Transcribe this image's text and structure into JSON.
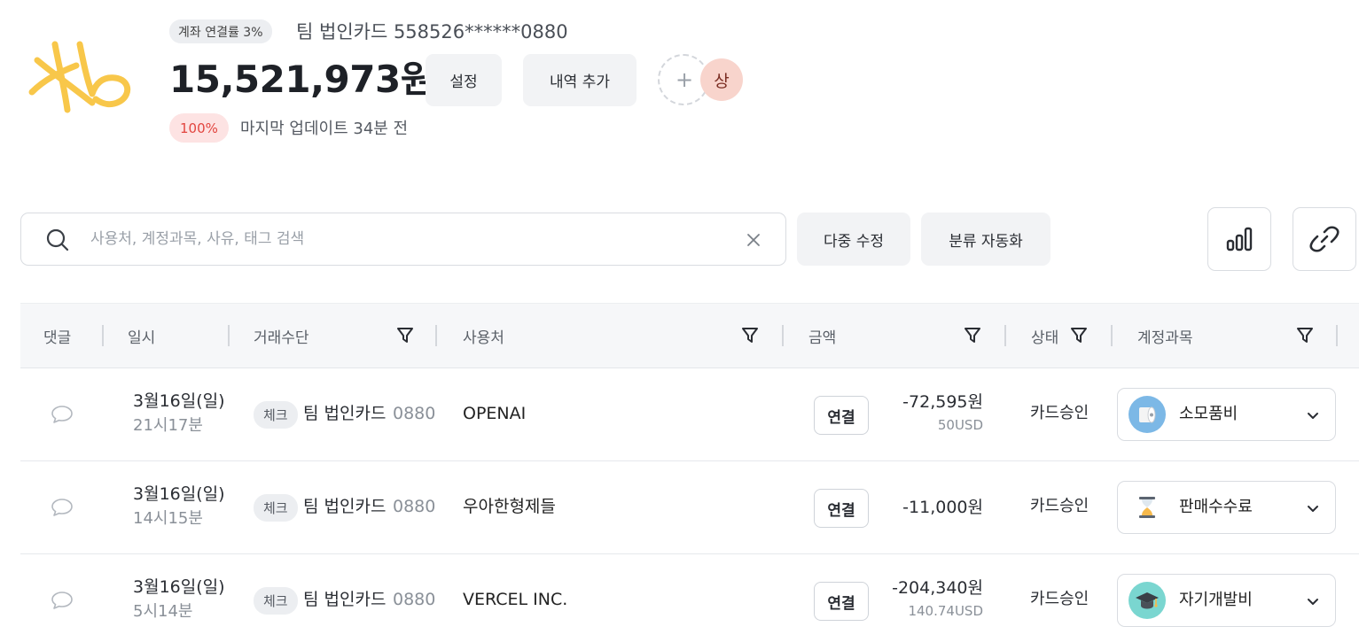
{
  "header": {
    "bank_logo_text": "kb",
    "link_rate_chip": "계좌 연결률 3%",
    "card_title": "팀 법인카드 558526******0880",
    "balance": "15,521,973원",
    "settings_label": "설정",
    "add_history_label": "내역 추가",
    "add_member_symbol": "+",
    "member_avatar": "상",
    "percent_chip": "100%",
    "last_update": "마지막 업데이트 34분 전"
  },
  "toolbar": {
    "search_placeholder": "사용처, 계정과목, 사유, 태그 검색",
    "multi_edit_label": "다중 수정",
    "auto_classify_label": "분류 자동화"
  },
  "table": {
    "columns": {
      "comment": "댓글",
      "date": "일시",
      "payment": "거래수단",
      "merchant": "사용처",
      "amount": "금액",
      "status": "상태",
      "account": "계정과목"
    },
    "rows": [
      {
        "date": "3월16일(일)",
        "time": "21시17분",
        "pay_type": "체크",
        "pay_name": "팀 법인카드",
        "pay_last4": "0880",
        "merchant": "OPENAI",
        "link_label": "연결",
        "amount": "-72,595원",
        "foreign_amount": "50USD",
        "status": "카드승인",
        "account": "소모품비",
        "account_icon": "toilet-paper-icon",
        "account_icon_bg": "#7cb8e6"
      },
      {
        "date": "3월16일(일)",
        "time": "14시15분",
        "pay_type": "체크",
        "pay_name": "팀 법인카드",
        "pay_last4": "0880",
        "merchant": "우아한형제들",
        "link_label": "연결",
        "amount": "-11,000원",
        "foreign_amount": "",
        "status": "카드승인",
        "account": "판매수수료",
        "account_icon": "hourglass-icon",
        "account_icon_bg": "#ffffff"
      },
      {
        "date": "3월16일(일)",
        "time": "5시14분",
        "pay_type": "체크",
        "pay_name": "팀 법인카드",
        "pay_last4": "0880",
        "merchant": "VERCEL INC.",
        "link_label": "연결",
        "amount": "-204,340원",
        "foreign_amount": "140.74USD",
        "status": "카드승인",
        "account": "자기개발비",
        "account_icon": "graduation-cap-icon",
        "account_icon_bg": "#7ad6d0"
      }
    ]
  },
  "colors": {
    "logo": "#f8c74a",
    "percent_chip_text": "#e2453f",
    "avatar_bg": "#f8d4cc"
  }
}
